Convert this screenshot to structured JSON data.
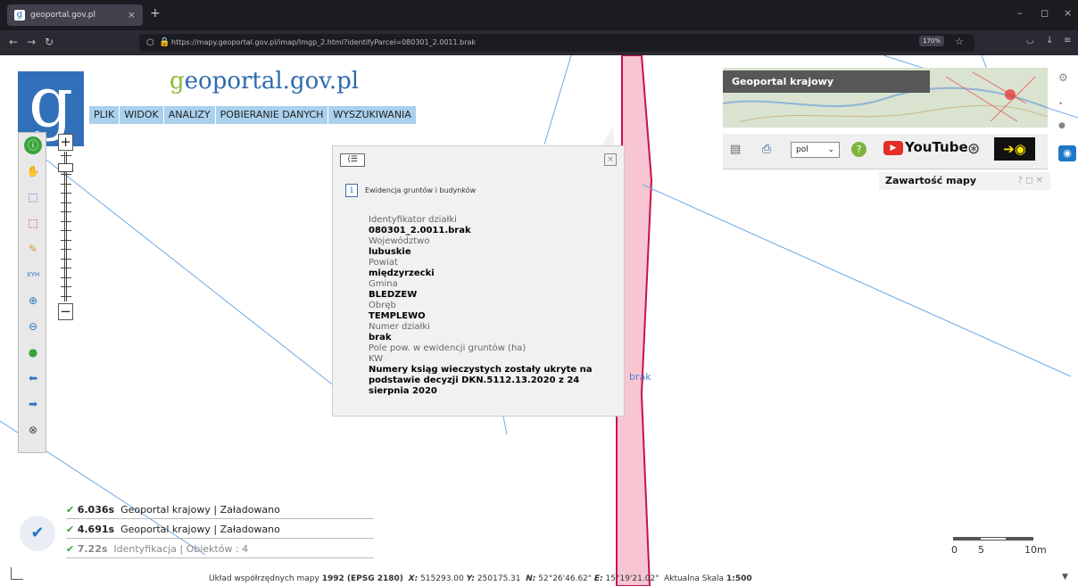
{
  "browser": {
    "tab_title": "geoportal.gov.pl",
    "tab_close": "×",
    "new_tab": "+",
    "url": "https://mapy.geoportal.gov.pl/imap/Imgp_2.html?identifyParcel=080301_2.0011.brak",
    "zoom": "170%",
    "window_controls": [
      "–",
      "◻",
      "×"
    ]
  },
  "site": {
    "logo_letter": "g",
    "title_g": "g",
    "title_rest": "eoportal.gov.pl",
    "menu": [
      "PLIK",
      "WIDOK",
      "ANALIZY",
      "POBIERANIE DANYCH",
      "WYSZUKIWANIA"
    ]
  },
  "tools": [
    {
      "icon": "info-icon",
      "glyph": "ⓘ",
      "color": "#3aa33a"
    },
    {
      "icon": "hand-pan-icon",
      "glyph": "✋",
      "color": "#d79a3a"
    },
    {
      "icon": "select-rectangle-icon",
      "glyph": "⬚",
      "color": "#2a75c3"
    },
    {
      "icon": "deselect-rectangle-icon",
      "glyph": "⬚",
      "color": "#d22"
    },
    {
      "icon": "pencil-icon",
      "glyph": "✎",
      "color": "#d79a3a"
    },
    {
      "icon": "xyh-coordinates-icon",
      "glyph": "XYH",
      "color": "#2a75c3"
    },
    {
      "icon": "zoom-in-icon",
      "glyph": "⊕",
      "color": "#2a75c3"
    },
    {
      "icon": "zoom-out-icon",
      "glyph": "⊖",
      "color": "#2a75c3"
    },
    {
      "icon": "globe-full-extent-icon",
      "glyph": "●",
      "color": "#3aa33a"
    },
    {
      "icon": "arrow-back-icon",
      "glyph": "⬅",
      "color": "#2a75c3"
    },
    {
      "icon": "arrow-forward-icon",
      "glyph": "➡",
      "color": "#2a75c3"
    },
    {
      "icon": "clear-icon",
      "glyph": "⊗",
      "color": "#444"
    }
  ],
  "zoom_control": {
    "plus": "+",
    "minus": "−",
    "level": 0.08
  },
  "popup": {
    "collapse_glyph": "⟨☰",
    "close_glyph": "×",
    "info_glyph": "i",
    "section": "Ewidencja gruntów i budynków",
    "attributes": [
      {
        "label": "Identyfikator działki",
        "value": "080301_2.0011.brak"
      },
      {
        "label": "Województwo",
        "value": "lubuskie"
      },
      {
        "label": "Powiat",
        "value": "międzyrzecki"
      },
      {
        "label": "Gmina",
        "value": "BLEDZEW"
      },
      {
        "label": "Obręb",
        "value": "TEMPLEWO"
      },
      {
        "label": "Numer działki",
        "value": "brak"
      },
      {
        "label": "Pole pow. w ewidencji gruntów (ha)",
        "value": ""
      },
      {
        "label": "KW",
        "value": "Numery ksiąg wieczystych zostały ukryte na podstawie decyzji DKN.5112.13.2020 z 24 sierpnia 2020"
      }
    ]
  },
  "minimap": {
    "label": "Geoportal krajowy"
  },
  "right_toolbar": {
    "language": "pol",
    "language_arrow": "⌄",
    "help_glyph": "?",
    "youtube_label": "YouTube",
    "youtube_play": "▶",
    "accessibility_glyph": "⊛",
    "contrast_glyph": "➔◉"
  },
  "map_contents": {
    "label": "Zawartość mapy",
    "icons": "? ◻ ✕"
  },
  "parcel_label": "brak",
  "status": [
    {
      "time": "6.036s",
      "source": "Geoportal krajowy",
      "state": "Załadowano",
      "dim": false
    },
    {
      "time": "4.691s",
      "source": "Geoportal krajowy",
      "state": "Załadowano",
      "dim": false
    },
    {
      "time": "7.22s",
      "source": "Identyfikacja",
      "state": "Obiektów : 4",
      "dim": true
    }
  ],
  "status_big_check": "✔",
  "scale": {
    "labels": [
      "0",
      "5",
      "10m"
    ]
  },
  "statusbar": {
    "system_label": "Układ współrzędnych mapy",
    "system_value": "1992 (EPSG 2180)",
    "x_label": "X:",
    "x_value": "515293.00",
    "y_label": "Y:",
    "y_value": "250175.31",
    "n_label": "N:",
    "n_value": "52°26'46.62\"",
    "e_label": "E:",
    "e_value": "15°19'21.02\"",
    "scale_label": "Aktualna Skala",
    "scale_value": "1:500"
  },
  "colors": {
    "parcel_fill": "#f7c6d2",
    "parcel_border": "#c4124e",
    "lines": "#6fa8e3",
    "logo": "#3170b8",
    "menu": "#a9d1ed"
  }
}
